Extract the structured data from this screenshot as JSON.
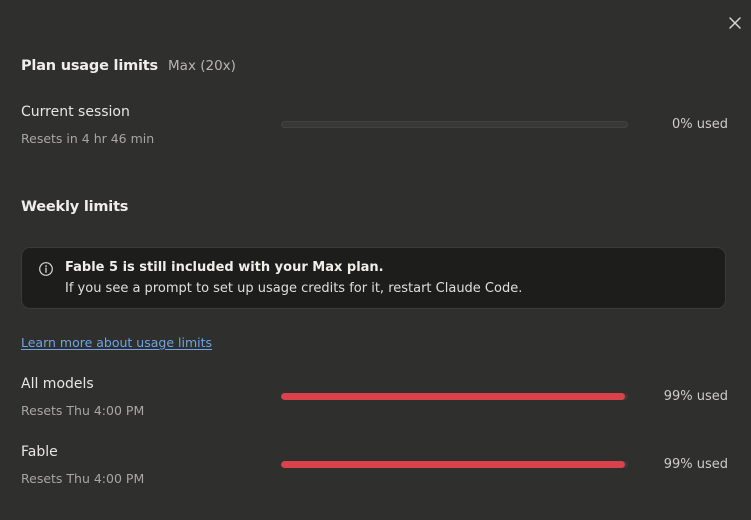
{
  "header": {
    "title": "Plan usage limits",
    "plan_tier": "Max (20x)"
  },
  "current_session": {
    "label": "Current session",
    "reset_text": "Resets in 4 hr 46 min",
    "percent_used": 0,
    "percent_label": "0% used"
  },
  "weekly": {
    "title": "Weekly limits",
    "notice": {
      "icon": "info-icon",
      "bold_text": "Fable 5 is still included with your Max plan.",
      "body_text": "If you see a prompt to set up usage credits for it, restart Claude Code."
    },
    "learn_more_link": "Learn more about usage limits",
    "limits": [
      {
        "label": "All models",
        "reset_text": "Resets Thu 4:00 PM",
        "percent_used": 99,
        "percent_label": "99% used"
      },
      {
        "label": "Fable",
        "reset_text": "Resets Thu 4:00 PM",
        "percent_used": 99,
        "percent_label": "99% used"
      }
    ]
  },
  "colors": {
    "background": "#2f2f2e",
    "bar_fill": "#d9414b",
    "link": "#6ea3e6",
    "notice_bg": "#1d1d1c"
  },
  "icons": {
    "close": "close-icon",
    "info": "info-icon"
  }
}
